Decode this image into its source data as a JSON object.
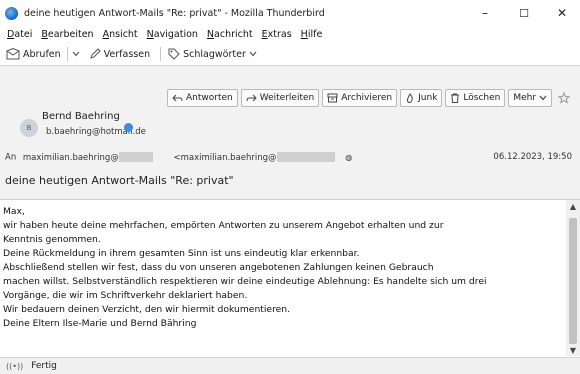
{
  "window": {
    "title": "deine heutigen Antwort-Mails \"Re: privat\" - Mozilla Thunderbird",
    "minimize": "–",
    "maximize": "☐",
    "close": "✕"
  },
  "menu": {
    "items": [
      {
        "first": "D",
        "rest": "atei"
      },
      {
        "first": "B",
        "rest": "earbeiten"
      },
      {
        "first": "A",
        "rest": "nsicht"
      },
      {
        "first": "N",
        "rest": "avigation"
      },
      {
        "first": "N",
        "rest": "achricht"
      },
      {
        "first": "E",
        "rest": "xtras"
      },
      {
        "first": "H",
        "rest": "ilfe"
      }
    ]
  },
  "toolbar": {
    "get_mail": "Abrufen",
    "compose": "Verfassen",
    "tags": "Schlagwörter"
  },
  "actions": {
    "reply": "Antworten",
    "forward": "Weiterleiten",
    "archive": "Archivieren",
    "junk": "Junk",
    "delete": "Löschen",
    "more": "Mehr"
  },
  "message": {
    "avatar_letter": "B",
    "sender_name": "Bernd Baehring",
    "sender_email": "b.baehring@hotmail.de",
    "to_label": "An",
    "to_name_start": "maximilian.baehring@",
    "to_addr_start": "<maximilian.baehring@",
    "date": "06.12.2023, 19:50",
    "subject": "deine heutigen Antwort-Mails \"Re: privat\""
  },
  "body": {
    "lines": [
      "Max,",
      "wir haben heute deine mehrfachen, empörten Antworten zu unserem Angebot erhalten und zur",
      "Kenntnis genommen.",
      "Deine Rückmeldung in ihrem gesamten Sinn ist uns eindeutig klar erkennbar.",
      "Abschließend stellen wir fest, dass du von unseren angebotenen Zahlungen keinen Gebrauch",
      "machen willst. Selbstverständlich respektieren wir deine eindeutige Ablehnung: Es handelte sich um drei",
      "Vorgänge, die wir im Schriftverkehr deklariert haben.",
      "Wir bedauern deinen Verzicht, den wir hiermit dokumentieren.",
      "Deine Eltern Ilse-Marie und Bernd Bähring"
    ]
  },
  "status": {
    "text": "Fertig"
  }
}
